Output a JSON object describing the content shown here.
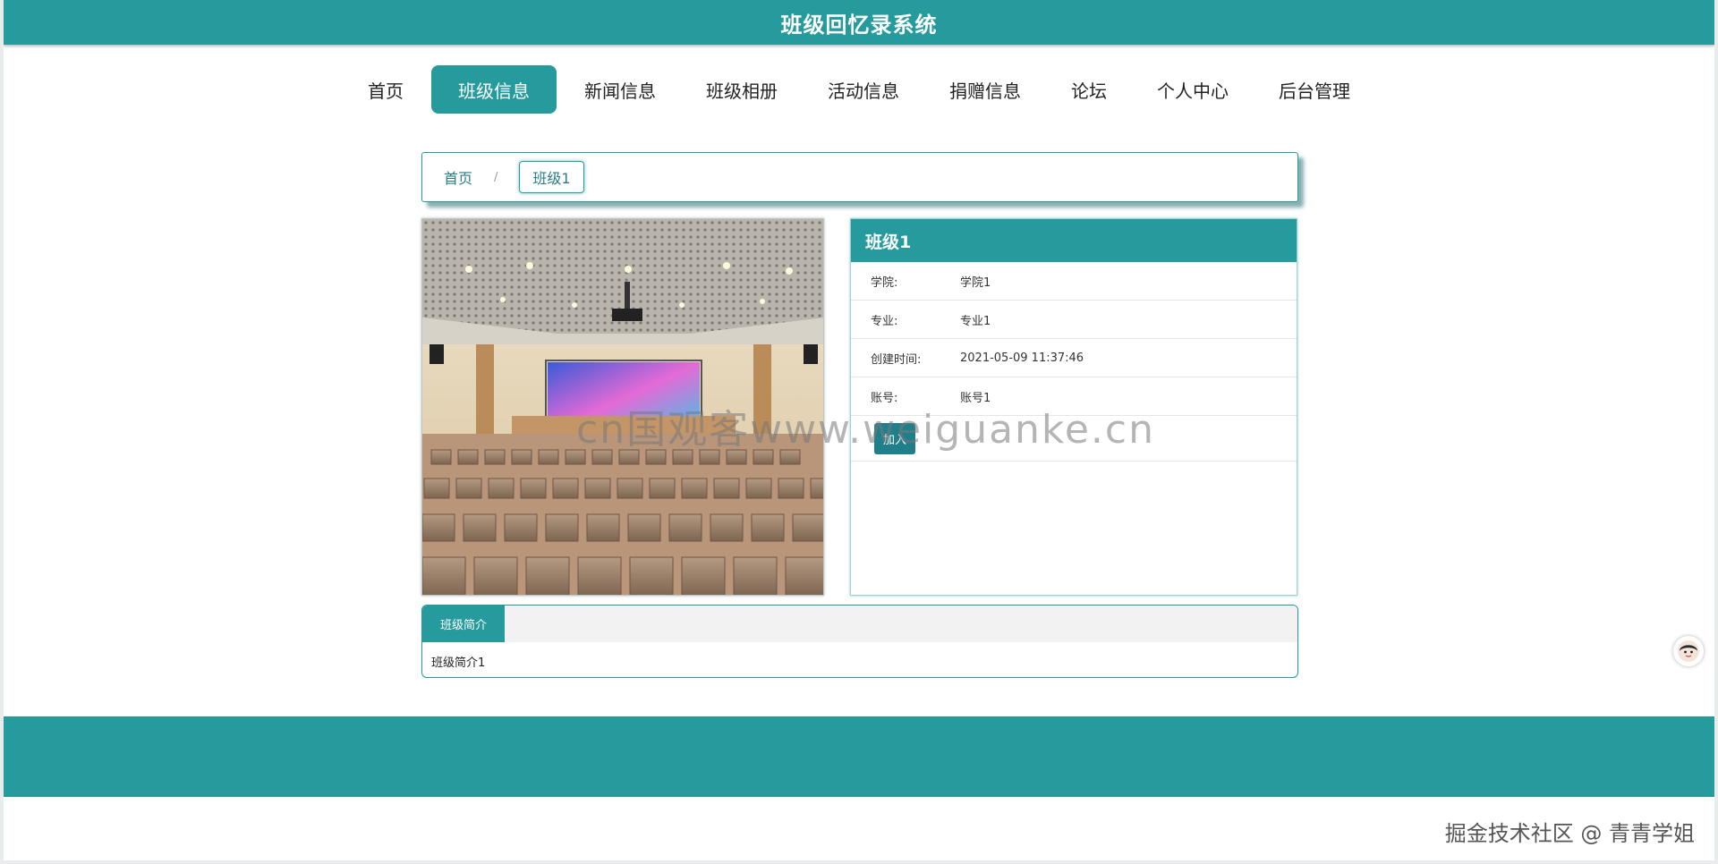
{
  "header": {
    "title": "班级回忆录系统"
  },
  "nav": {
    "items": [
      {
        "label": "首页"
      },
      {
        "label": "班级信息"
      },
      {
        "label": "新闻信息"
      },
      {
        "label": "班级相册"
      },
      {
        "label": "活动信息"
      },
      {
        "label": "捐赠信息"
      },
      {
        "label": "论坛"
      },
      {
        "label": "个人中心"
      },
      {
        "label": "后台管理"
      }
    ],
    "active": "班级信息"
  },
  "breadcrumb": {
    "home": "首页",
    "separator": "/",
    "current": "班级1"
  },
  "detail": {
    "title": "班级1",
    "fields": [
      {
        "label": "学院:",
        "value": "学院1"
      },
      {
        "label": "专业:",
        "value": "专业1"
      },
      {
        "label": "创建时间:",
        "value": "2021-05-09 11:37:46"
      },
      {
        "label": "账号:",
        "value": "账号1"
      }
    ],
    "join_label": "加入"
  },
  "photo": {
    "icon": "auditorium-image"
  },
  "intro": {
    "tab_label": "班级简介",
    "content": "班级简介1"
  },
  "watermark": "cn国观客www.weiguanke.cn",
  "credit": "掘金技术社区 @ 青青学姐",
  "colors": {
    "primary": "#269b9d",
    "dark": "#1f7f8a"
  }
}
